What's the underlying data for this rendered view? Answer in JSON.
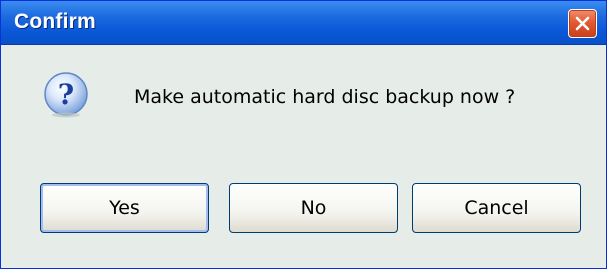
{
  "window": {
    "title": "Confirm",
    "close_icon": "close-icon"
  },
  "dialog": {
    "icon": "question-icon",
    "message": "Make automatic hard disc backup now ?"
  },
  "buttons": {
    "yes": "Yes",
    "no": "No",
    "cancel": "Cancel"
  },
  "colors": {
    "titlebar": "#0a58d8",
    "close_button": "#e25a32",
    "dialog_background": "#e6ede9"
  }
}
